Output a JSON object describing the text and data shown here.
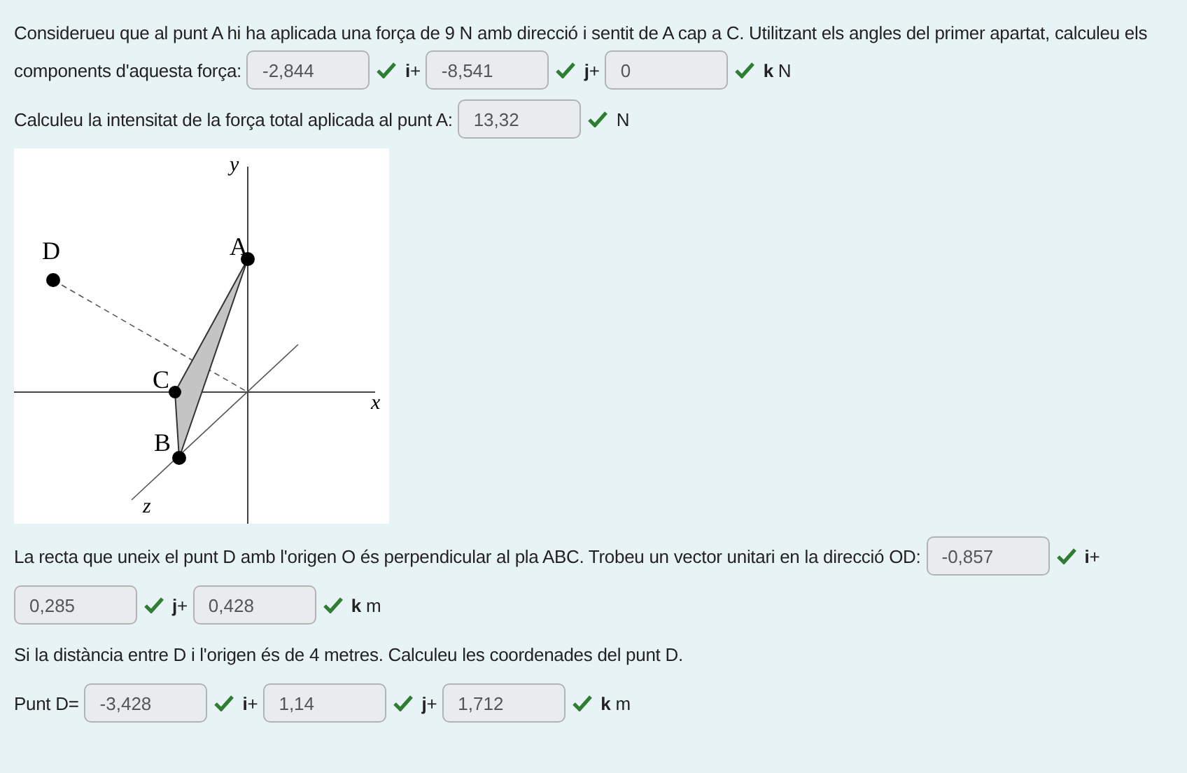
{
  "blocks": [
    {
      "kind": "line",
      "parts": [
        {
          "kind": "text",
          "text": "Considerueu que al punt A hi ha aplicada una força de 9 N amb direcció i sentit de A cap a C. Utilitzant els angles del primer apartat, calculeu els"
        }
      ]
    },
    {
      "kind": "line",
      "parts": [
        {
          "kind": "text",
          "text": "components d'aquesta força:"
        },
        {
          "kind": "field",
          "value": "-2,844",
          "correct": true
        },
        {
          "kind": "text",
          "text": "**i**+"
        },
        {
          "kind": "field",
          "value": "-8,541",
          "correct": true
        },
        {
          "kind": "text",
          "text": "**j**+"
        },
        {
          "kind": "field",
          "value": "0",
          "correct": true
        },
        {
          "kind": "text",
          "text": "**k** N"
        }
      ]
    },
    {
      "kind": "line",
      "parts": [
        {
          "kind": "text",
          "text": "Calculeu la intensitat de la força total aplicada al punt A:"
        },
        {
          "kind": "field",
          "value": "13,32",
          "correct": true
        },
        {
          "kind": "text",
          "text": "N"
        }
      ]
    },
    {
      "kind": "diagram",
      "axis_labels": [
        "y",
        "x",
        "z"
      ],
      "point_labels": [
        "D",
        "A",
        "C",
        "B"
      ]
    },
    {
      "kind": "line",
      "parts": [
        {
          "kind": "text",
          "text": "La recta que uneix el punt D amb l'origen O és perpendicular al pla ABC. Trobeu un vector unitari en la direcció OD:"
        },
        {
          "kind": "field",
          "value": "-0,857",
          "correct": true
        },
        {
          "kind": "text",
          "text": "**i**+"
        }
      ]
    },
    {
      "kind": "line",
      "parts": [
        {
          "kind": "field",
          "value": "0,285",
          "correct": true
        },
        {
          "kind": "text",
          "text": "**j**+"
        },
        {
          "kind": "field",
          "value": "0,428",
          "correct": true
        },
        {
          "kind": "text",
          "text": "**k** m"
        }
      ]
    },
    {
      "kind": "line",
      "parts": [
        {
          "kind": "text",
          "text": "Si la distància entre D i l'origen és de 4 metres. Calculeu les coordenades del punt D."
        }
      ]
    },
    {
      "kind": "line",
      "parts": [
        {
          "kind": "text",
          "text": "Punt D="
        },
        {
          "kind": "field",
          "value": "-3,428",
          "correct": true
        },
        {
          "kind": "text",
          "text": "**i**+"
        },
        {
          "kind": "field",
          "value": "1,14",
          "correct": true
        },
        {
          "kind": "text",
          "text": "**j**+"
        },
        {
          "kind": "field",
          "value": "1,712",
          "correct": true
        },
        {
          "kind": "text",
          "text": "**k** m"
        }
      ]
    }
  ]
}
